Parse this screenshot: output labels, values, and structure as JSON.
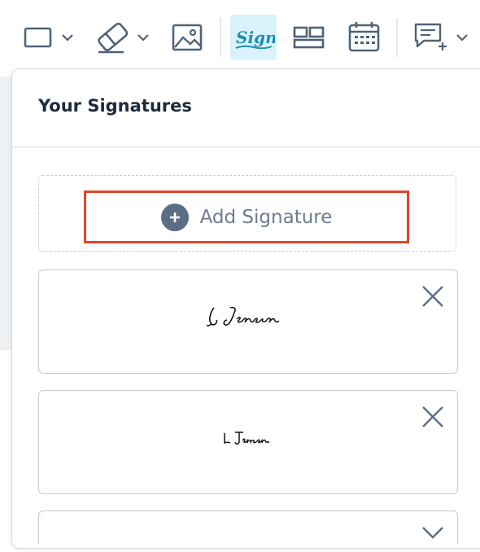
{
  "toolbar": {
    "tools": [
      {
        "name": "rectangle-tool",
        "icon": "rectangle-icon",
        "has_dropdown": true
      },
      {
        "name": "eraser-tool",
        "icon": "eraser-icon",
        "has_dropdown": true
      },
      {
        "name": "image-tool",
        "icon": "image-icon",
        "has_dropdown": false
      },
      {
        "name": "sign-tool",
        "icon": "sign-icon",
        "label": "Sign",
        "active": true
      },
      {
        "name": "layout-tool",
        "icon": "layout-icon",
        "has_dropdown": false
      },
      {
        "name": "date-tool",
        "icon": "calendar-icon",
        "has_dropdown": false
      },
      {
        "name": "comment-tool",
        "icon": "comment-add-icon",
        "has_dropdown": true
      }
    ]
  },
  "panel": {
    "title": "Your Signatures",
    "add_button_label": "Add Signature",
    "signatures": [
      {
        "text": "L Jensen",
        "style": "cursive"
      },
      {
        "text": "L Jensen",
        "style": "small-script"
      }
    ]
  },
  "colors": {
    "accent_highlight": "#e0452b",
    "active_tool_bg": "#d9f2fb",
    "sign_text": "#1b8fb0",
    "icon": "#5b6f84"
  }
}
